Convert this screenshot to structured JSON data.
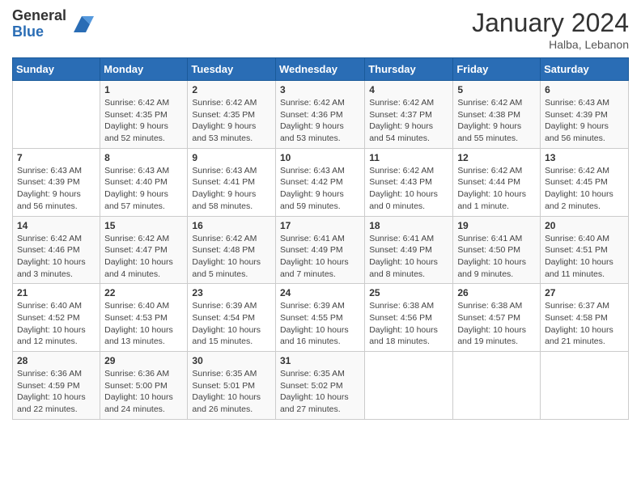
{
  "logo": {
    "general": "General",
    "blue": "Blue"
  },
  "header": {
    "month": "January 2024",
    "location": "Halba, Lebanon"
  },
  "days_of_week": [
    "Sunday",
    "Monday",
    "Tuesday",
    "Wednesday",
    "Thursday",
    "Friday",
    "Saturday"
  ],
  "weeks": [
    [
      {
        "day": "",
        "info": ""
      },
      {
        "day": "1",
        "info": "Sunrise: 6:42 AM\nSunset: 4:35 PM\nDaylight: 9 hours\nand 52 minutes."
      },
      {
        "day": "2",
        "info": "Sunrise: 6:42 AM\nSunset: 4:35 PM\nDaylight: 9 hours\nand 53 minutes."
      },
      {
        "day": "3",
        "info": "Sunrise: 6:42 AM\nSunset: 4:36 PM\nDaylight: 9 hours\nand 53 minutes."
      },
      {
        "day": "4",
        "info": "Sunrise: 6:42 AM\nSunset: 4:37 PM\nDaylight: 9 hours\nand 54 minutes."
      },
      {
        "day": "5",
        "info": "Sunrise: 6:42 AM\nSunset: 4:38 PM\nDaylight: 9 hours\nand 55 minutes."
      },
      {
        "day": "6",
        "info": "Sunrise: 6:43 AM\nSunset: 4:39 PM\nDaylight: 9 hours\nand 56 minutes."
      }
    ],
    [
      {
        "day": "7",
        "info": "Sunrise: 6:43 AM\nSunset: 4:39 PM\nDaylight: 9 hours\nand 56 minutes."
      },
      {
        "day": "8",
        "info": "Sunrise: 6:43 AM\nSunset: 4:40 PM\nDaylight: 9 hours\nand 57 minutes."
      },
      {
        "day": "9",
        "info": "Sunrise: 6:43 AM\nSunset: 4:41 PM\nDaylight: 9 hours\nand 58 minutes."
      },
      {
        "day": "10",
        "info": "Sunrise: 6:43 AM\nSunset: 4:42 PM\nDaylight: 9 hours\nand 59 minutes."
      },
      {
        "day": "11",
        "info": "Sunrise: 6:42 AM\nSunset: 4:43 PM\nDaylight: 10 hours\nand 0 minutes."
      },
      {
        "day": "12",
        "info": "Sunrise: 6:42 AM\nSunset: 4:44 PM\nDaylight: 10 hours\nand 1 minute."
      },
      {
        "day": "13",
        "info": "Sunrise: 6:42 AM\nSunset: 4:45 PM\nDaylight: 10 hours\nand 2 minutes."
      }
    ],
    [
      {
        "day": "14",
        "info": "Sunrise: 6:42 AM\nSunset: 4:46 PM\nDaylight: 10 hours\nand 3 minutes."
      },
      {
        "day": "15",
        "info": "Sunrise: 6:42 AM\nSunset: 4:47 PM\nDaylight: 10 hours\nand 4 minutes."
      },
      {
        "day": "16",
        "info": "Sunrise: 6:42 AM\nSunset: 4:48 PM\nDaylight: 10 hours\nand 5 minutes."
      },
      {
        "day": "17",
        "info": "Sunrise: 6:41 AM\nSunset: 4:49 PM\nDaylight: 10 hours\nand 7 minutes."
      },
      {
        "day": "18",
        "info": "Sunrise: 6:41 AM\nSunset: 4:49 PM\nDaylight: 10 hours\nand 8 minutes."
      },
      {
        "day": "19",
        "info": "Sunrise: 6:41 AM\nSunset: 4:50 PM\nDaylight: 10 hours\nand 9 minutes."
      },
      {
        "day": "20",
        "info": "Sunrise: 6:40 AM\nSunset: 4:51 PM\nDaylight: 10 hours\nand 11 minutes."
      }
    ],
    [
      {
        "day": "21",
        "info": "Sunrise: 6:40 AM\nSunset: 4:52 PM\nDaylight: 10 hours\nand 12 minutes."
      },
      {
        "day": "22",
        "info": "Sunrise: 6:40 AM\nSunset: 4:53 PM\nDaylight: 10 hours\nand 13 minutes."
      },
      {
        "day": "23",
        "info": "Sunrise: 6:39 AM\nSunset: 4:54 PM\nDaylight: 10 hours\nand 15 minutes."
      },
      {
        "day": "24",
        "info": "Sunrise: 6:39 AM\nSunset: 4:55 PM\nDaylight: 10 hours\nand 16 minutes."
      },
      {
        "day": "25",
        "info": "Sunrise: 6:38 AM\nSunset: 4:56 PM\nDaylight: 10 hours\nand 18 minutes."
      },
      {
        "day": "26",
        "info": "Sunrise: 6:38 AM\nSunset: 4:57 PM\nDaylight: 10 hours\nand 19 minutes."
      },
      {
        "day": "27",
        "info": "Sunrise: 6:37 AM\nSunset: 4:58 PM\nDaylight: 10 hours\nand 21 minutes."
      }
    ],
    [
      {
        "day": "28",
        "info": "Sunrise: 6:36 AM\nSunset: 4:59 PM\nDaylight: 10 hours\nand 22 minutes."
      },
      {
        "day": "29",
        "info": "Sunrise: 6:36 AM\nSunset: 5:00 PM\nDaylight: 10 hours\nand 24 minutes."
      },
      {
        "day": "30",
        "info": "Sunrise: 6:35 AM\nSunset: 5:01 PM\nDaylight: 10 hours\nand 26 minutes."
      },
      {
        "day": "31",
        "info": "Sunrise: 6:35 AM\nSunset: 5:02 PM\nDaylight: 10 hours\nand 27 minutes."
      },
      {
        "day": "",
        "info": ""
      },
      {
        "day": "",
        "info": ""
      },
      {
        "day": "",
        "info": ""
      }
    ]
  ]
}
